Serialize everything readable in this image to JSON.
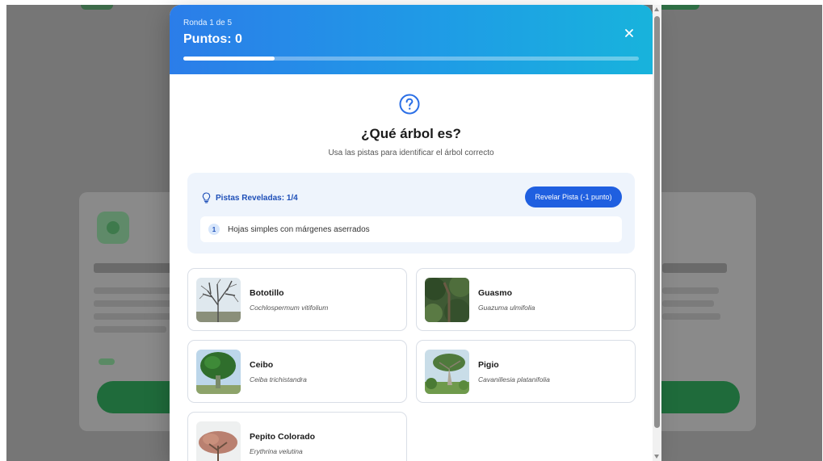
{
  "header": {
    "round": "Ronda 1 de 5",
    "points": "Puntos: 0",
    "progress": 0.2,
    "close_icon": "close-icon"
  },
  "question": {
    "icon": "question-circle-icon",
    "title": "¿Qué árbol es?",
    "subtitle": "Usa las pistas para identificar el árbol correcto"
  },
  "hints": {
    "icon": "lightbulb-icon",
    "count_label": "Pistas Reveladas: 1/4",
    "reveal_button": "Revelar Pista (-1 punto)",
    "items": [
      {
        "number": "1",
        "text": "Hojas simples con márgenes aserrados"
      }
    ]
  },
  "options": [
    {
      "name": "Bototillo",
      "scientific": "Cochlospermum vitifolium"
    },
    {
      "name": "Guasmo",
      "scientific": "Guazuma ulmifolia"
    },
    {
      "name": "Ceibo",
      "scientific": "Ceiba trichistandra"
    },
    {
      "name": "Pigio",
      "scientific": "Cavanillesia platanifolia"
    },
    {
      "name": "Pepito Colorado",
      "scientific": "Erythrina velutina"
    }
  ],
  "colors": {
    "header_gradient_start": "#2b7de9",
    "header_gradient_end": "#18b3dc",
    "accent_blue": "#1f5fe0",
    "hint_panel_bg": "#eef4fc"
  }
}
